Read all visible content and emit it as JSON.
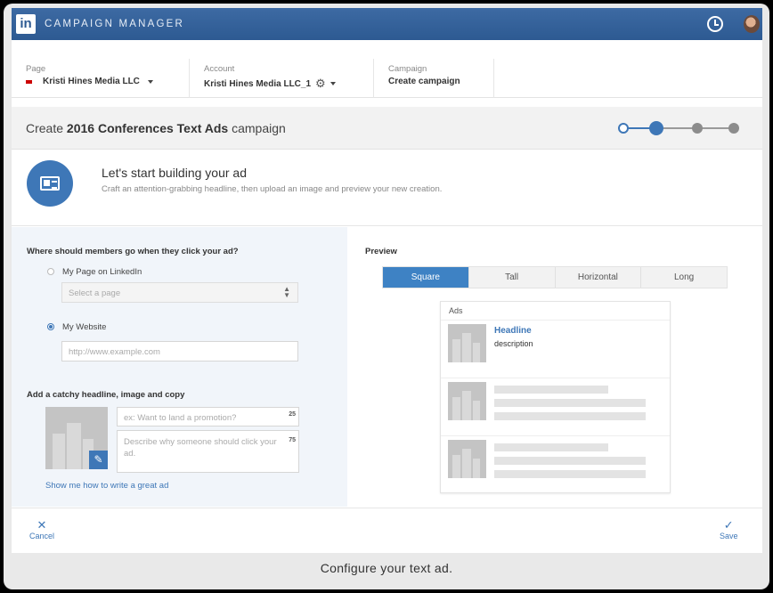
{
  "app": {
    "logo": "in",
    "name": "CAMPAIGN MANAGER",
    "icons": [
      "clock-icon",
      "avatar"
    ]
  },
  "context": {
    "page": {
      "label": "Page",
      "value": "Kristi Hines Media LLC"
    },
    "account": {
      "label": "Account",
      "value": "Kristi Hines Media LLC_1"
    },
    "campaign": {
      "label": "Campaign",
      "value": "Create campaign"
    }
  },
  "title": {
    "prefix": "Create",
    "name": "2016 Conferences Text Ads",
    "suffix": "campaign"
  },
  "progress": {
    "total_steps": 4,
    "current_step": 2
  },
  "intro": {
    "heading": "Let's start building your ad",
    "subtext": "Craft an attention-grabbing headline, then upload an image and preview your new creation."
  },
  "destination": {
    "question": "Where should members go when they click your ad?",
    "option_page": "My Page on LinkedIn",
    "select_placeholder": "Select a page",
    "option_website": "My Website",
    "website_placeholder": "http://www.example.com",
    "selected": "website"
  },
  "creative": {
    "heading": "Add a catchy headline, image and copy",
    "headline_placeholder": "ex: Want to land a promotion?",
    "headline_counter": "25",
    "description_placeholder": "Describe why someone should click your ad.",
    "description_counter": "75",
    "help_link": "Show me how to write a great ad"
  },
  "preview": {
    "label": "Preview",
    "tabs": [
      "Square",
      "Tall",
      "Horizontal",
      "Long"
    ],
    "active_tab": "Square",
    "ads_header": "Ads",
    "ad_headline": "Headline",
    "ad_description": "description"
  },
  "footer": {
    "cancel": "Cancel",
    "save": "Save"
  },
  "caption": "Configure your text ad.",
  "colors": {
    "brand": "#2d5a92",
    "accent": "#3e77b7",
    "active_tab": "#3e82c4"
  }
}
